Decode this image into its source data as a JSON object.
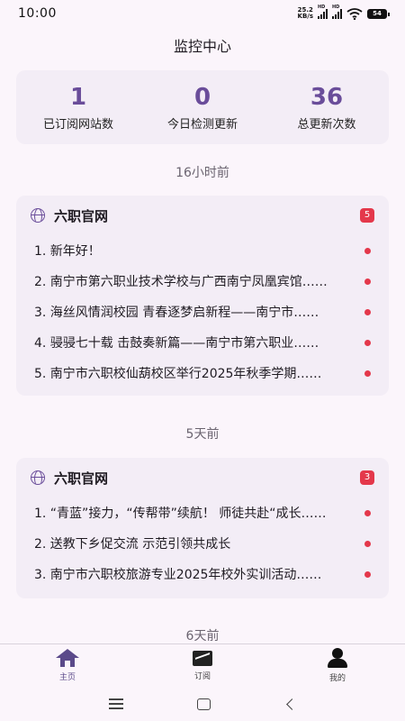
{
  "status_bar": {
    "time": "10:00",
    "speed_value": "25.2",
    "speed_unit": "KB/s",
    "hd1": "HD",
    "hd2": "HD",
    "battery": "54"
  },
  "page_title": "监控中心",
  "stats": [
    {
      "value": "1",
      "label": "已订阅网站数"
    },
    {
      "value": "0",
      "label": "今日检测更新"
    },
    {
      "value": "36",
      "label": "总更新次数"
    }
  ],
  "groups": [
    {
      "time_label": "16小时前",
      "site_name": "六职官网",
      "count": "5",
      "items": [
        "1. 新年好！",
        "2. 南宁市第六职业技术学校与广西南宁凤凰宾馆……",
        "3. 海丝风情润校园 青春逐梦启新程——南宁市……",
        "4. 骎骎七十载 击鼓奏新篇——南宁市第六职业……",
        "5. 南宁市六职校仙葫校区举行2025年秋季学期……"
      ]
    },
    {
      "time_label": "5天前",
      "site_name": "六职官网",
      "count": "3",
      "items": [
        "1. “青蓝”接力，“传帮带”续航！ 师徒共赴“成长……",
        "2. 送教下乡促交流 示范引领共成长",
        "3. 南宁市六职校旅游专业2025年校外实训活动……"
      ]
    },
    {
      "time_label": "6天前"
    }
  ],
  "bottom_nav": [
    {
      "label": "主页",
      "icon": "home-icon"
    },
    {
      "label": "订阅",
      "icon": "chart-icon"
    },
    {
      "label": "我的",
      "icon": "user-icon"
    }
  ],
  "colors": {
    "accent": "#6a4d9a",
    "badge": "#e4384b",
    "card": "#f3edf6",
    "background": "#fbf5fb"
  }
}
